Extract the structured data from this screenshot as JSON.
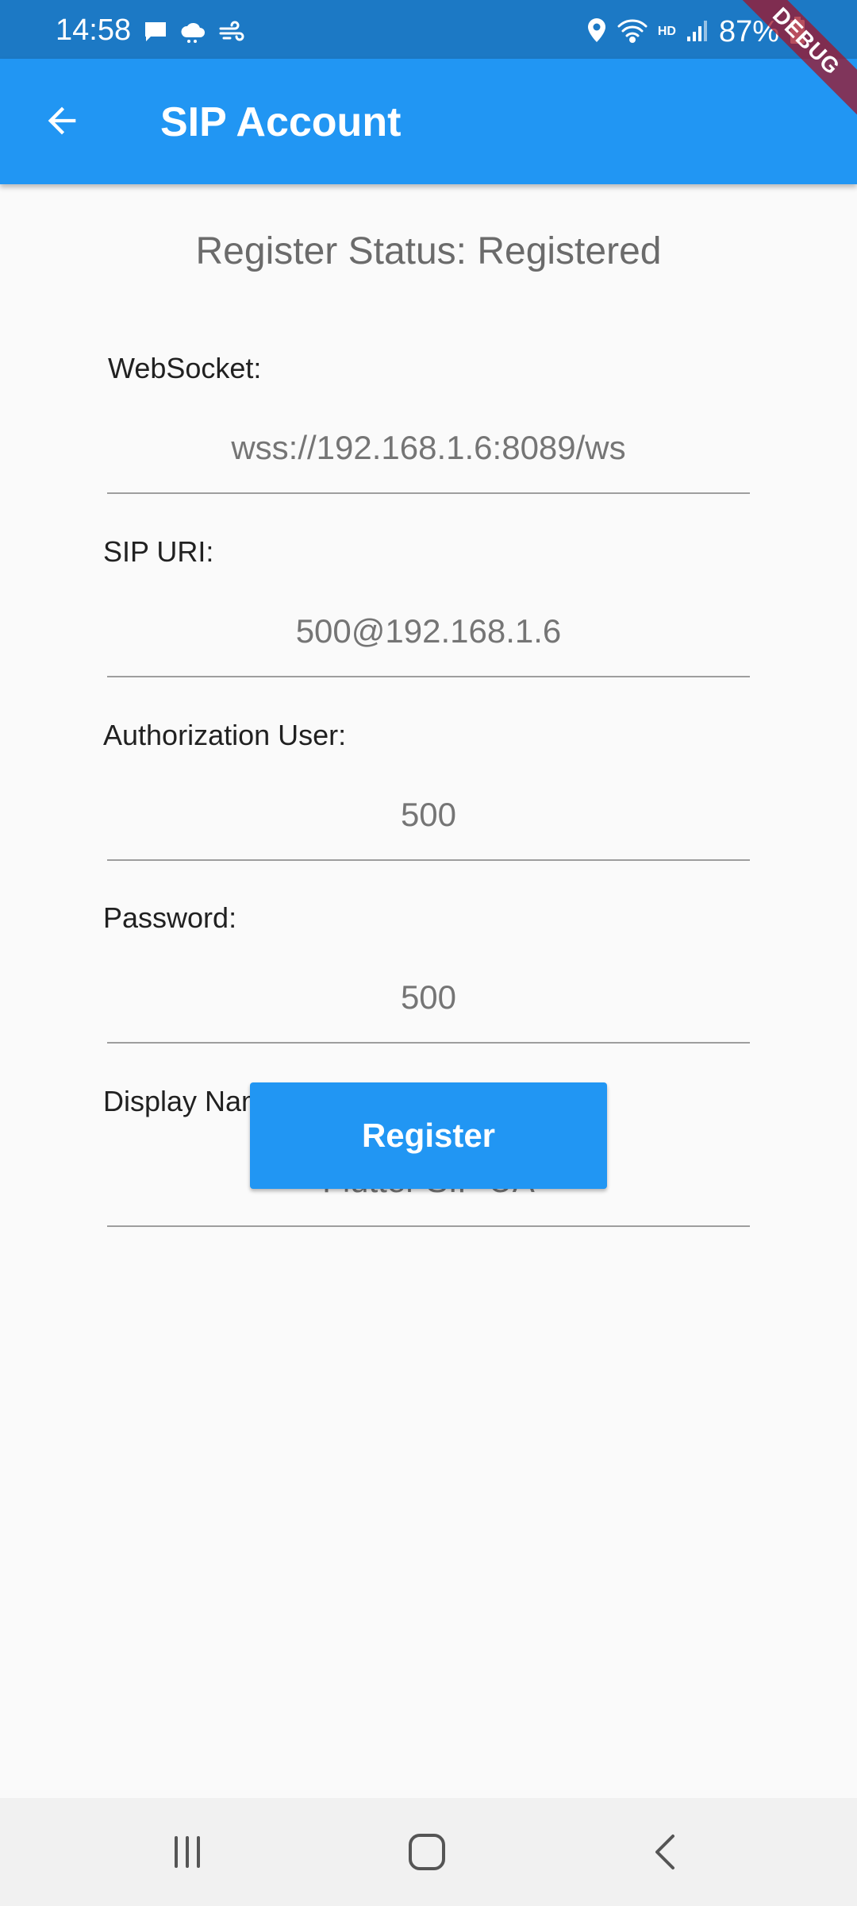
{
  "status_bar": {
    "time": "14:58",
    "battery": "87%",
    "hd": "HD",
    "left_icons": [
      "chat-icon",
      "cloud-icon",
      "wind-icon"
    ],
    "right_icons": [
      "location-icon",
      "wifi-icon",
      "signal-icon",
      "battery-icon"
    ]
  },
  "debug_banner": "DEBUG",
  "app_bar": {
    "title": "SIP Account",
    "back_icon": "arrow-back-icon",
    "color": "#2196f3"
  },
  "register_status": "Register Status: Registered",
  "form": {
    "websocket": {
      "label": "WebSocket:",
      "value": "wss://192.168.1.6:8089/ws"
    },
    "sip_uri": {
      "label": "SIP URI:",
      "value": "500@192.168.1.6"
    },
    "auth_user": {
      "label": "Authorization User:",
      "value": "500"
    },
    "password": {
      "label": "Password:",
      "value": "500"
    },
    "display_name": {
      "label": "Display Name:",
      "value": "Flutter SIP UA"
    }
  },
  "register_button": "Register",
  "nav_bar": {
    "icons": [
      "recent-apps-icon",
      "home-icon",
      "back-icon"
    ]
  }
}
